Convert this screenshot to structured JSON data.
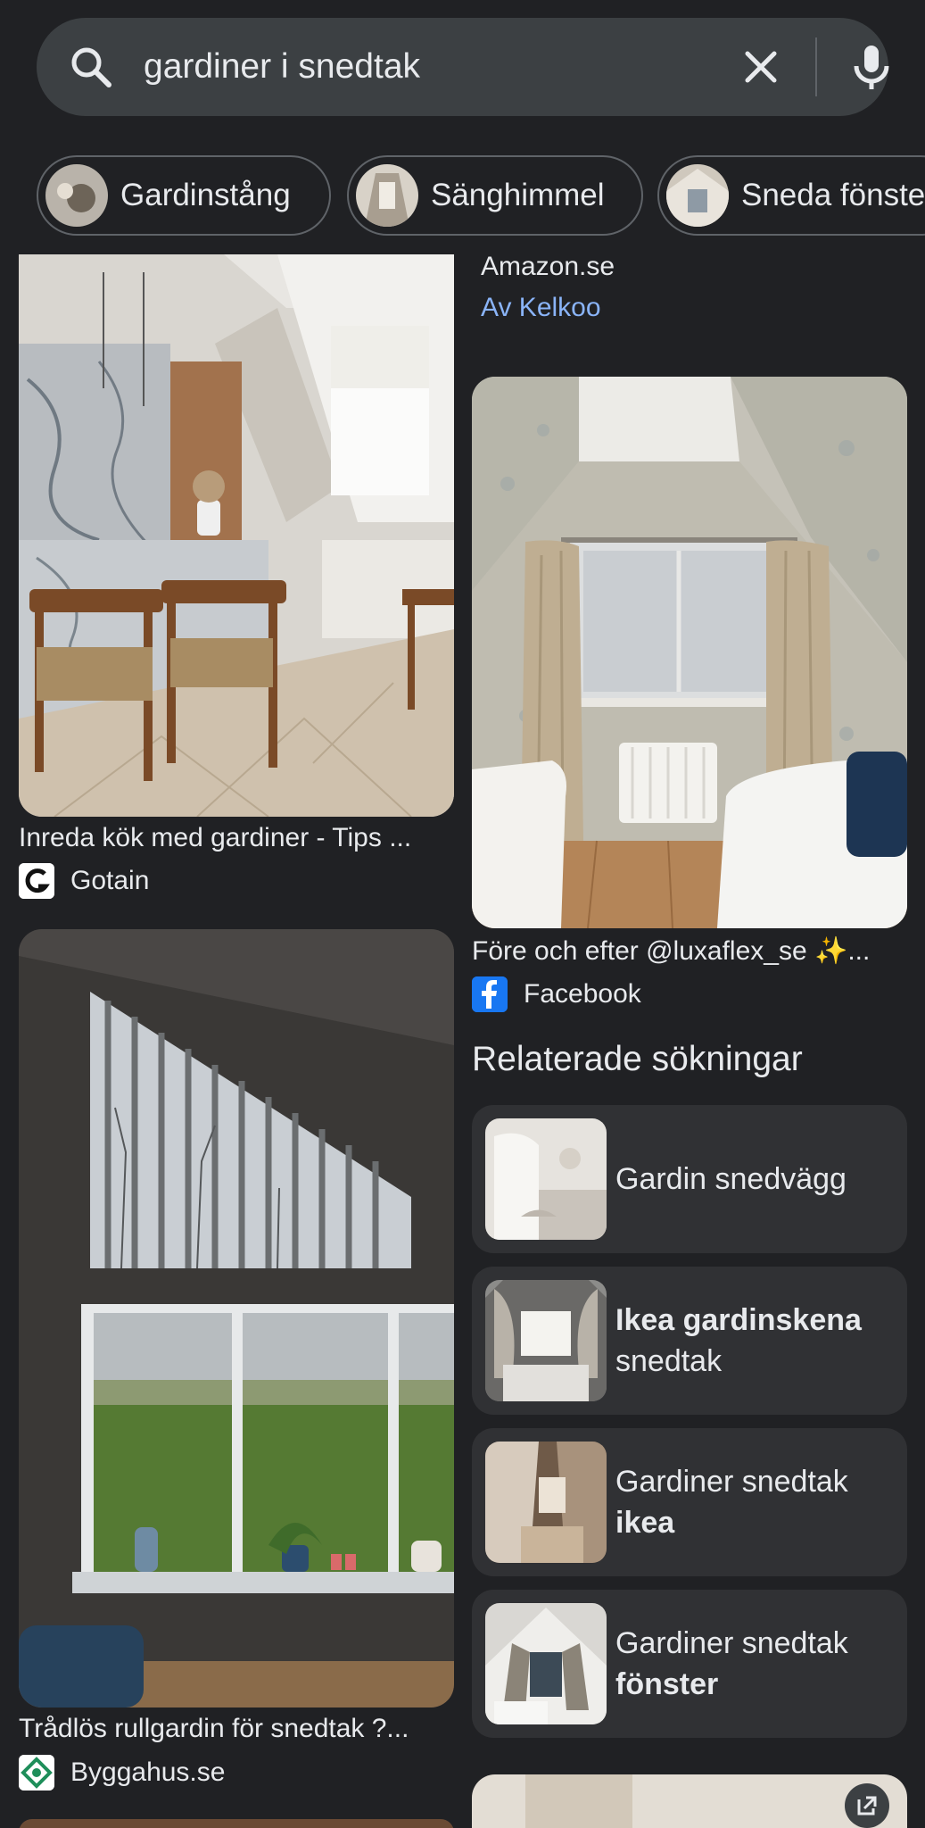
{
  "search": {
    "query": "gardiner i snedtak",
    "icons": {
      "search": "search-icon",
      "clear": "close-icon",
      "voice": "mic-icon"
    }
  },
  "chips": [
    {
      "label": "Gardinstång"
    },
    {
      "label": "Sänghimmel"
    },
    {
      "label": "Sneda fönster"
    }
  ],
  "results": {
    "shopping_partial": {
      "store": "Amazon.se",
      "via": "Av Kelkoo"
    },
    "card1": {
      "title": "Inreda kök med gardiner - Tips ...",
      "source": "Gotain"
    },
    "card2": {
      "title": "Före och efter @luxaflex_se ✨...",
      "source": "Facebook"
    },
    "card3": {
      "title": "Trådlös rullgardin för snedtak ?...",
      "source": "Byggahus.se"
    }
  },
  "related": {
    "title": "Relaterade sökningar",
    "items": [
      {
        "plain": "Gardin snedvägg",
        "bold": "",
        "rest": ""
      },
      {
        "plain": "",
        "bold": "Ikea gardinskena",
        "rest": "snedtak"
      },
      {
        "plain": "Gardiner snedtak",
        "bold": "ikea",
        "rest": ""
      },
      {
        "plain": "Gardiner snedtak",
        "bold": "fönster",
        "rest": ""
      }
    ]
  },
  "colors": {
    "background": "#202124",
    "searchbar": "#3c4043",
    "card": "#303134",
    "link": "#8ab4f8",
    "text": "#e8eaed",
    "facebook": "#1877f2"
  }
}
